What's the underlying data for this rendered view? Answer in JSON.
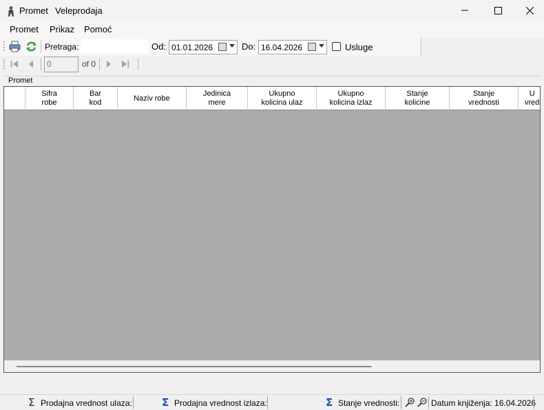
{
  "window": {
    "title": "Promet",
    "subtitle": "Veleprodaja",
    "icon": "app-figure-icon",
    "controls": {
      "minimize": "—",
      "maximize": "☐",
      "close": "✕"
    }
  },
  "menu": [
    "Promet",
    "Prikaz",
    "Pomoć"
  ],
  "toolbar": {
    "search_label": "Pretraga:",
    "search_value": "",
    "from_label": "Od:",
    "from_date": "01.01.2026",
    "to_label": "Do:",
    "to_date": "16.04.2026",
    "services_label": "Usluge",
    "services_checked": false
  },
  "navigator": {
    "position": "0",
    "of_label": "of 0"
  },
  "group_label": "Promet",
  "grid": {
    "columns": [
      "Sifra\nrobe",
      "Bar\nkod",
      "Naziv robe",
      "Jedinica\nmere",
      "Ukupno\nkolicina ulaz",
      "Ukupno\nkolicina izlaz",
      "Stanje\nkolicine",
      "Stanje\nvrednosti",
      "U\nvred"
    ],
    "rows": []
  },
  "status": {
    "sales_in_label": "Prodajna vrednost ulaza:",
    "sales_out_label": "Prodajna vrednost izlaza:",
    "stock_value_label": "Stanje vrednosti:",
    "posting_date_label": "Datum knjiženja: 16.04.2026"
  },
  "colors": {
    "accent": "#1a4fb5",
    "grid_background": "#ababab",
    "menubar": "#f8f5f7"
  }
}
